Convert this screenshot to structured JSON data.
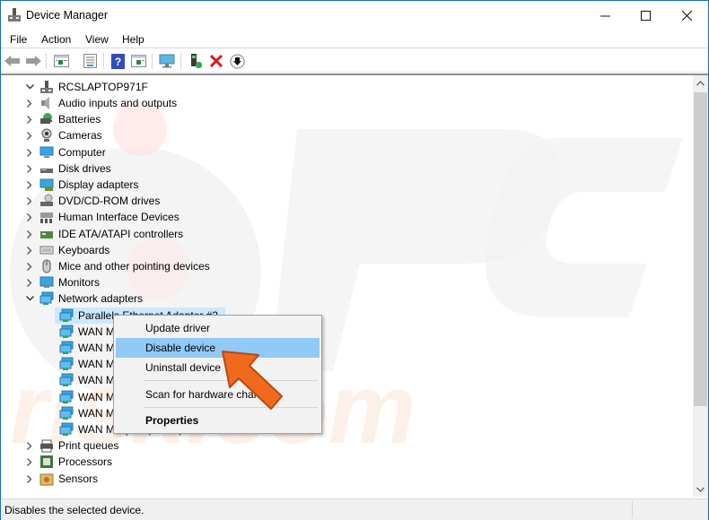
{
  "window": {
    "title": "Device Manager",
    "controls": {
      "minimize": "—",
      "maximize": "☐",
      "close": "✕"
    }
  },
  "menubar": {
    "items": [
      {
        "label": "File"
      },
      {
        "label": "Action"
      },
      {
        "label": "View"
      },
      {
        "label": "Help"
      }
    ]
  },
  "toolbar": {
    "buttons": [
      {
        "name": "back",
        "icon": "arrow-left-icon"
      },
      {
        "name": "forward",
        "icon": "arrow-right-icon"
      },
      {
        "name": "show-hide-console-tree",
        "icon": "console-tree-icon"
      },
      {
        "name": "properties",
        "icon": "properties-icon"
      },
      {
        "name": "help",
        "icon": "help-icon",
        "glyph": "?"
      },
      {
        "name": "show-action-pane",
        "icon": "action-pane-icon"
      },
      {
        "name": "scan-hardware",
        "icon": "monitor-scan-icon"
      },
      {
        "name": "update-driver",
        "icon": "update-driver-icon"
      },
      {
        "name": "uninstall-device",
        "icon": "red-x-icon",
        "glyph": "✖"
      },
      {
        "name": "disable-device",
        "icon": "down-arrow-circle-icon",
        "glyph": "⬇"
      }
    ]
  },
  "tree": {
    "root": {
      "label": "RCSLAPTOP971F",
      "expanded": true
    },
    "categories": [
      {
        "label": "Audio inputs and outputs",
        "icon": "speaker-icon",
        "expanded": false
      },
      {
        "label": "Batteries",
        "icon": "battery-icon",
        "expanded": false
      },
      {
        "label": "Cameras",
        "icon": "camera-icon",
        "expanded": false
      },
      {
        "label": "Computer",
        "icon": "computer-icon",
        "expanded": false
      },
      {
        "label": "Disk drives",
        "icon": "disk-drive-icon",
        "expanded": false
      },
      {
        "label": "Display adapters",
        "icon": "display-adapter-icon",
        "expanded": false
      },
      {
        "label": "DVD/CD-ROM drives",
        "icon": "dvd-drive-icon",
        "expanded": false
      },
      {
        "label": "Human Interface Devices",
        "icon": "hid-icon",
        "expanded": false
      },
      {
        "label": "IDE ATA/ATAPI controllers",
        "icon": "ide-controller-icon",
        "expanded": false
      },
      {
        "label": "Keyboards",
        "icon": "keyboard-icon",
        "expanded": false
      },
      {
        "label": "Mice and other pointing devices",
        "icon": "mouse-icon",
        "expanded": false
      },
      {
        "label": "Monitors",
        "icon": "monitor-icon",
        "expanded": false
      },
      {
        "label": "Network adapters",
        "icon": "network-adapter-icon",
        "expanded": true
      }
    ],
    "network_children": [
      {
        "label": "Parallels Ethernet Adapter #2",
        "selected": true
      },
      {
        "label": "WAN M"
      },
      {
        "label": "WAN M"
      },
      {
        "label": "WAN M"
      },
      {
        "label": "WAN M"
      },
      {
        "label": "WAN M"
      },
      {
        "label": "WAN Miniport (PPTP)"
      },
      {
        "label": "WAN Miniport (SSTP)"
      }
    ],
    "after_categories": [
      {
        "label": "Print queues",
        "icon": "printer-icon",
        "expanded": false
      },
      {
        "label": "Processors",
        "icon": "processor-icon",
        "expanded": false
      },
      {
        "label": "Sensors",
        "icon": "sensor-icon",
        "expanded": false
      }
    ]
  },
  "context_menu": {
    "items": [
      {
        "label": "Update driver"
      },
      {
        "label": "Disable device",
        "highlighted": true
      },
      {
        "label": "Uninstall device"
      },
      {
        "label": "Scan for hardware changes"
      },
      {
        "label": "Properties",
        "bold": true
      }
    ]
  },
  "statusbar": {
    "text": "Disables the selected device."
  },
  "colors": {
    "window_border": "#1c6fb8",
    "selection": "#cce8ff",
    "menu_hover": "#91c9f7",
    "pointer_arrow": "#f06a1e"
  }
}
